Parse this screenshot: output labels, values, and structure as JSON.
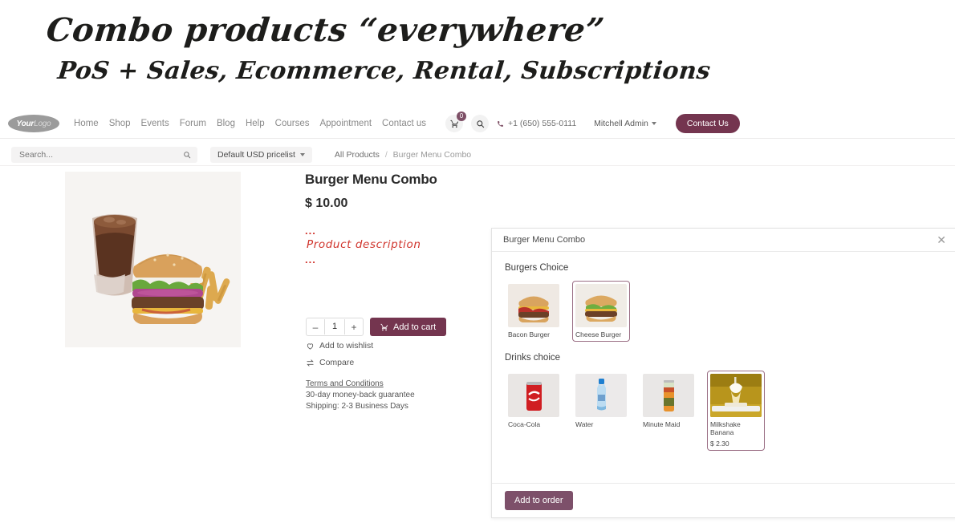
{
  "headline": {
    "line1": "Combo products “everywhere”",
    "line2": "PoS + Sales, Ecommerce, Rental, Subscriptions"
  },
  "navbar": {
    "logo_main": "Your",
    "logo_sub": "Logo",
    "links": [
      {
        "label": "Home"
      },
      {
        "label": "Shop"
      },
      {
        "label": "Events"
      },
      {
        "label": "Forum"
      },
      {
        "label": "Blog"
      },
      {
        "label": "Help"
      },
      {
        "label": "Courses"
      },
      {
        "label": "Appointment"
      },
      {
        "label": "Contact us"
      }
    ],
    "cart_count": "0",
    "phone": "+1 (650) 555-0111",
    "user": "Mitchell Admin",
    "contact_button": "Contact Us"
  },
  "searchrow": {
    "placeholder": "Search...",
    "pricelist": "Default USD pricelist",
    "breadcrumb_root": "All Products",
    "breadcrumb_sep": "/",
    "breadcrumb_current": "Burger Menu Combo"
  },
  "product": {
    "title": "Burger Menu Combo",
    "price": "$ 10.00",
    "dots_top": "...",
    "description_note": "Product description",
    "dots_bottom": "...",
    "quantity": "1",
    "minus": "–",
    "plus": "+",
    "add_to_cart": "Add to cart",
    "wishlist": "Add to wishlist",
    "compare": "Compare",
    "terms": "Terms and Conditions",
    "guarantee": "30-day money-back guarantee",
    "shipping": "Shipping: 2-3 Business Days"
  },
  "modal": {
    "title": "Burger Menu Combo",
    "close": "✕",
    "sections": [
      {
        "title": "Burgers Choice",
        "options": [
          {
            "label": "Bacon Burger",
            "price": "",
            "selected": false
          },
          {
            "label": "Cheese Burger",
            "price": "",
            "selected": true
          }
        ]
      },
      {
        "title": "Drinks choice",
        "options": [
          {
            "label": "Coca-Cola",
            "price": "",
            "selected": false
          },
          {
            "label": "Water",
            "price": "",
            "selected": false
          },
          {
            "label": "Minute Maid",
            "price": "",
            "selected": false
          },
          {
            "label": "Milkshake Banana",
            "price": "$ 2.30",
            "selected": true
          }
        ]
      }
    ],
    "add_to_order": "Add to order"
  },
  "colors": {
    "brand": "#74354f",
    "accent_selected": "#9b6f85",
    "annotation_red": "#d0342c",
    "button_modal": "#7d506a"
  }
}
